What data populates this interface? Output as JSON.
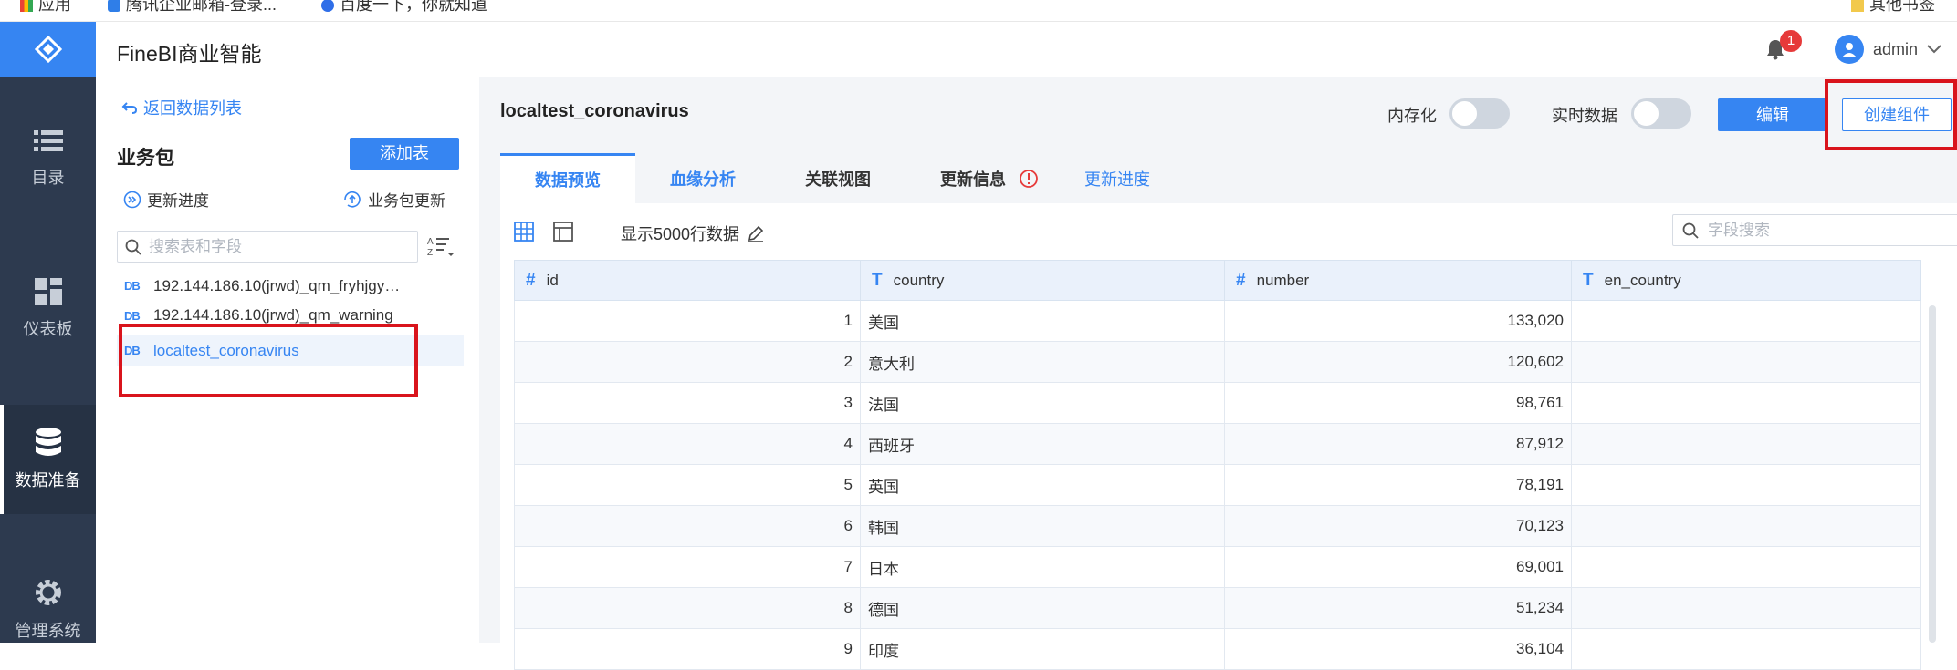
{
  "bookmarks": [
    {
      "label": "应用",
      "icon": "apps-icon"
    },
    {
      "label": "腾讯企业邮箱-登录...",
      "icon": "mail-icon"
    },
    {
      "label": "百度一下，你就知道",
      "icon": "baidu-icon"
    },
    {
      "label": "其他书签",
      "icon": "folder-icon"
    }
  ],
  "header": {
    "app_title": "FineBI商业智能",
    "notification_count": "1",
    "user": "admin"
  },
  "nav": {
    "items": [
      {
        "label": "目录",
        "icon": "list-icon"
      },
      {
        "label": "仪表板",
        "icon": "dashboard-icon"
      },
      {
        "label": "数据准备",
        "icon": "database-icon"
      },
      {
        "label": "管理系统",
        "icon": "gear-icon"
      }
    ]
  },
  "left_panel": {
    "back_label": "返回数据列表",
    "title": "业务包",
    "add_table_label": "添加表",
    "update_progress_label": "更新进度",
    "package_update_label": "业务包更新",
    "search_placeholder": "搜索表和字段",
    "tables": [
      "192.144.186.10(jrwd)_qm_fryhjgy…",
      "192.144.186.10(jrwd)_qm_warning",
      "localtest_coronavirus"
    ]
  },
  "main": {
    "table_name": "localtest_coronavirus",
    "memory_label": "内存化",
    "realtime_label": "实时数据",
    "edit_label": "编辑",
    "create_component_label": "创建组件",
    "tabs": [
      "数据预览",
      "血缘分析",
      "关联视图",
      "更新信息",
      "更新进度"
    ],
    "show_rows_label": "显示5000行数据",
    "field_search_placeholder": "字段搜索",
    "columns": [
      {
        "name": "id",
        "type": "#"
      },
      {
        "name": "country",
        "type": "T"
      },
      {
        "name": "number",
        "type": "#"
      },
      {
        "name": "en_country",
        "type": "T"
      }
    ],
    "rows": [
      [
        "1",
        "美国",
        "133,020",
        ""
      ],
      [
        "2",
        "意大利",
        "120,602",
        ""
      ],
      [
        "3",
        "法国",
        "98,761",
        ""
      ],
      [
        "4",
        "西班牙",
        "87,912",
        ""
      ],
      [
        "5",
        "英国",
        "78,191",
        ""
      ],
      [
        "6",
        "韩国",
        "70,123",
        ""
      ],
      [
        "7",
        "日本",
        "69,001",
        ""
      ],
      [
        "8",
        "德国",
        "51,234",
        ""
      ],
      [
        "9",
        "印度",
        "36,104",
        ""
      ]
    ]
  },
  "colors": {
    "accent": "#3685f2",
    "nav_bg": "#2d3a4f",
    "annotation": "#d9141c"
  }
}
